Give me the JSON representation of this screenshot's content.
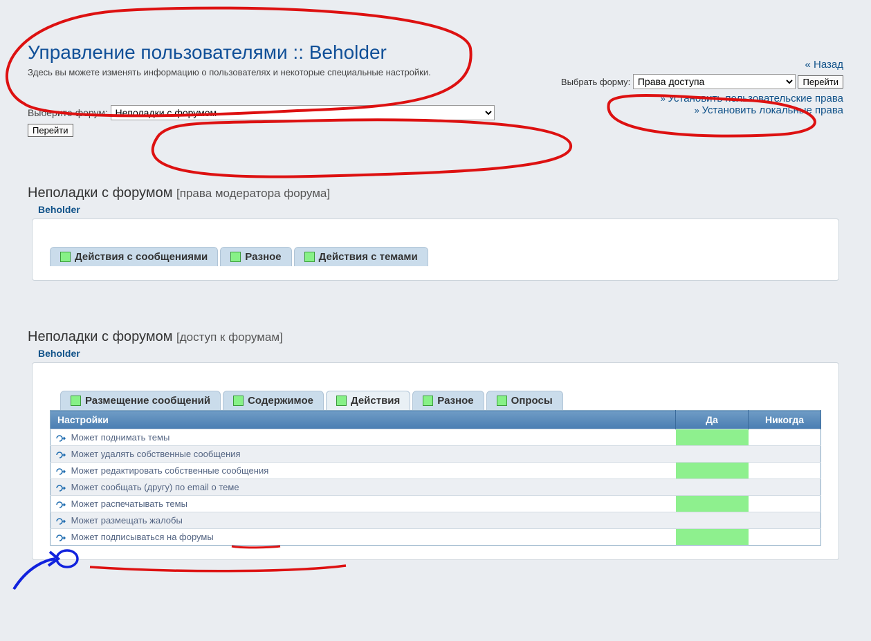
{
  "header": {
    "title": "Управление пользователями :: Beholder",
    "description": "Здесь вы можете изменять информацию о пользователях и некоторые специальные настройки.",
    "back_label": "« Назад"
  },
  "forum_select": {
    "label": "Выберите форум:",
    "selected": "    Неполадки с форумом",
    "go_label": "Перейти"
  },
  "form_select": {
    "label": "Выбрать форму:",
    "selected": "Права доступа",
    "go_label": "Перейти"
  },
  "quick_links": {
    "user_perms": "Установить пользовательские права",
    "local_perms": "Установить локальные права"
  },
  "section1": {
    "title": "Неполадки с форумом",
    "subtitle": "[права модератора форума]",
    "username": "Beholder",
    "tabs": [
      {
        "label": "Действия с сообщениями"
      },
      {
        "label": "Разное"
      },
      {
        "label": "Действия с темами"
      }
    ]
  },
  "section2": {
    "title": "Неполадки с форумом",
    "subtitle": "[доступ к форумам]",
    "username": "Beholder",
    "tabs": [
      {
        "label": "Размещение сообщений"
      },
      {
        "label": "Содержимое"
      },
      {
        "label": "Действия",
        "active": true
      },
      {
        "label": "Разное"
      },
      {
        "label": "Опросы"
      }
    ],
    "table": {
      "header_settings": "Настройки",
      "header_yes": "Да",
      "header_never": "Никогда",
      "rows": [
        {
          "label": "Может поднимать темы",
          "alt": false
        },
        {
          "label": "Может удалять собственные сообщения",
          "alt": true
        },
        {
          "label": "Может редактировать собственные сообщения",
          "alt": false
        },
        {
          "label": "Может сообщать (другу) по email о теме",
          "alt": true
        },
        {
          "label": "Может распечатывать темы",
          "alt": false
        },
        {
          "label": "Может размещать жалобы",
          "alt": true
        },
        {
          "label": "Может подписываться на форумы",
          "alt": false
        }
      ]
    }
  }
}
